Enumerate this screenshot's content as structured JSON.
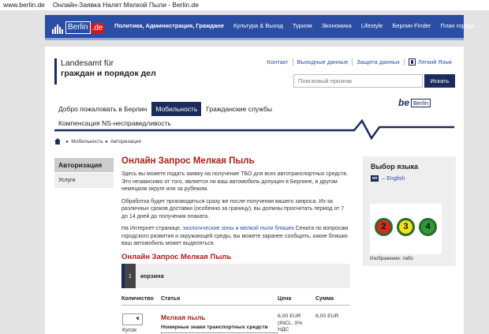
{
  "browser": {
    "domain": "www.berlin.de",
    "tab_title": "Онлайн-Заявка Налет Мелкой Пыли - Berlin.de"
  },
  "topnav": {
    "logo_text": "Berlin",
    "logo_suffix": ".de",
    "items": [
      "Политика, Администрация, Граждане",
      "Культура & Выход",
      "Туризм",
      "Экономика",
      "Lifestyle",
      "Берлин Finder",
      "План города"
    ]
  },
  "brand": {
    "line1": "Landesamt für",
    "line2": "граждан и порядок дел"
  },
  "utility": [
    "Контакт",
    "Выходные данные",
    "Защита данных",
    "Легкий Язык"
  ],
  "search": {
    "placeholder": "Поисковый признак",
    "button": "Искать"
  },
  "mainnav": {
    "items": [
      "Добро пожаловать в Берлин",
      "Мобильность",
      "Гражданские службы"
    ],
    "second_line": "Компенсация NS-несправедливость"
  },
  "be_logo": {
    "be": "be",
    "berlin": "Berlin"
  },
  "breadcrumb": [
    "Мобильность",
    "Авторизация"
  ],
  "leftnav": {
    "header": "Авторизация",
    "items": [
      "Услуги"
    ]
  },
  "content": {
    "title": "Онлайн Запрос Мелкая Пыль",
    "p1": "Здесь вы можете подать заявку на получение ТБО для всех автотранспортных средств. Это независимо от того, является ли ваш автомобиль допущен в Берлине, в другом немецком округе или за рубежом.",
    "p2": "Обработка будет производиться сразу же после получения вашего запроса. Из-за различных сроков доставки (особенно за границу), вы должны просчитать период от 7 до 14 дней до получения плаката.",
    "p3_before": "На Интернет-странице, ",
    "p3_link": "экологические зоны и мелкой пыли бляшек",
    "p3_after": " Сената по вопросам городского развития и окружающей среды, вы можете заранее сообщить, какие бляшки ваш автомобиль может выделяться.",
    "subtitle": "Онлайн Запрос Мелкая Пыль"
  },
  "cart": {
    "step_number": "1",
    "step_label": "корзина",
    "columns": [
      "Количество",
      "Статья",
      "Цена",
      "Сумма"
    ],
    "quantity": "1",
    "quantity_label": "Кусок",
    "item_name": "Мелкая пыль",
    "item_sub": "Номерные знаки транспортных средств",
    "price": "6,00 EUR (INCL. 0% НДС",
    "sum": "6,00 EUR"
  },
  "language": {
    "title": "Выбор языка",
    "code": "en",
    "label": "– English"
  },
  "image": {
    "discs": [
      {
        "number": "2",
        "color": "#d62a1f"
      },
      {
        "number": "3",
        "color": "#f0e21a"
      },
      {
        "number": "4",
        "color": "#2e9a3a"
      }
    ],
    "caption": "Изображение: лабо"
  }
}
